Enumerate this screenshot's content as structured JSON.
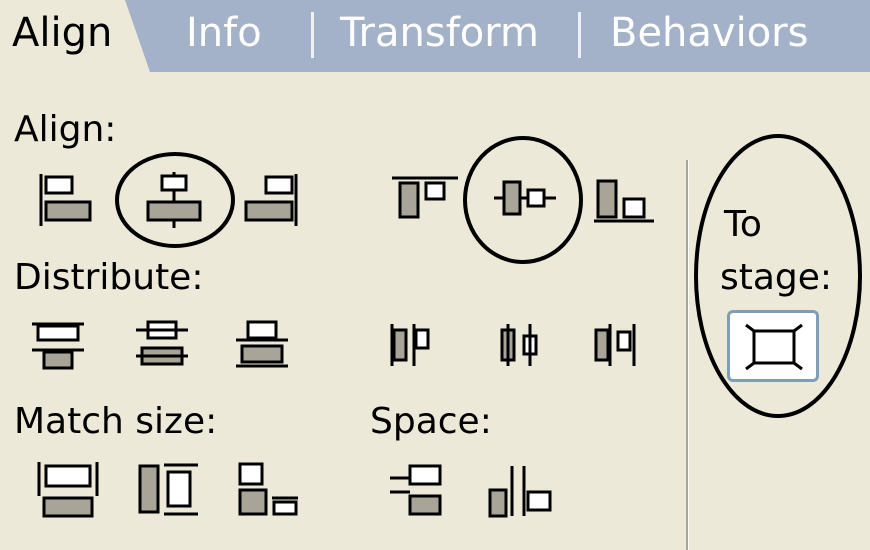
{
  "tabs": [
    {
      "label": "Align",
      "active": true
    },
    {
      "label": "Info",
      "active": false
    },
    {
      "label": "Transform",
      "active": false
    },
    {
      "label": "Behaviors",
      "active": false
    }
  ],
  "align_section": {
    "label": "Align:",
    "buttons": [
      "align-left-edge-icon",
      "align-horizontal-center-icon",
      "align-right-edge-icon",
      "align-top-edge-icon",
      "align-vertical-center-icon",
      "align-bottom-edge-icon"
    ]
  },
  "distribute_section": {
    "label": "Distribute:",
    "buttons": [
      "distribute-top-icon",
      "distribute-vertical-center-icon",
      "distribute-bottom-icon",
      "distribute-left-icon",
      "distribute-horizontal-center-icon",
      "distribute-right-icon"
    ]
  },
  "match_size_section": {
    "label": "Match size:",
    "buttons": [
      "match-width-icon",
      "match-height-icon",
      "match-width-and-height-icon"
    ]
  },
  "space_section": {
    "label": "Space:",
    "buttons": [
      "space-evenly-vertically-icon",
      "space-evenly-horizontally-icon"
    ]
  },
  "to_stage": {
    "label_line1": "To",
    "label_line2": "stage:",
    "button_icon": "to-stage-icon"
  },
  "colors": {
    "panel_bg": "#ece9d8",
    "tab_bar_bg": "#a3b2c8",
    "shape_fill": "#a8a598",
    "annotation_stroke": "#000000"
  }
}
